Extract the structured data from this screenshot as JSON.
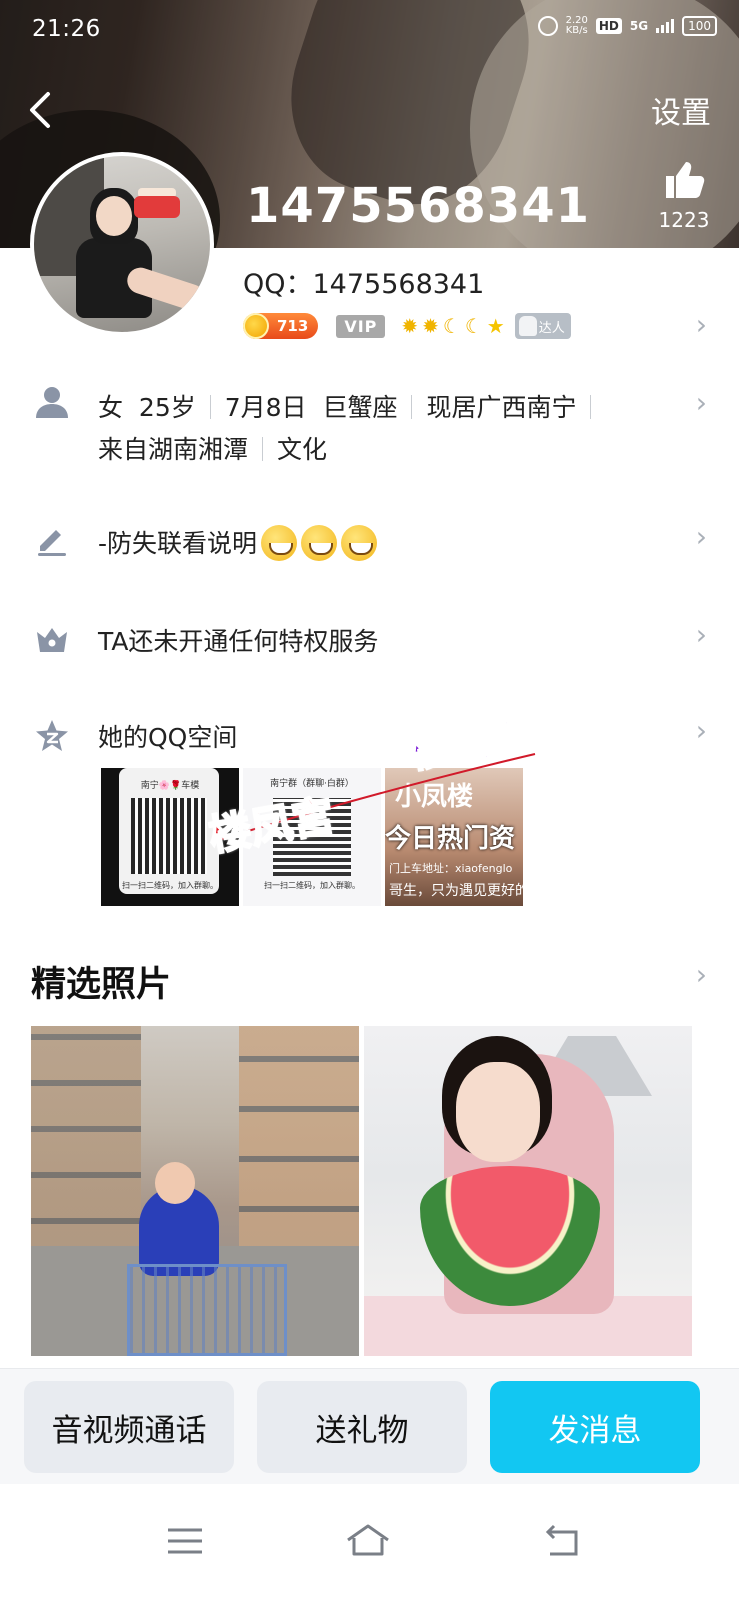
{
  "status_bar": {
    "time": "21:26",
    "net_speed_value": "2.20",
    "net_speed_unit": "KB/s",
    "hd": "HD",
    "network": "5G",
    "battery": "100"
  },
  "header": {
    "back_icon": "chevron-left-icon",
    "settings_label": "设置",
    "nickname": "1475568341",
    "like_icon": "thumbs-up-icon",
    "like_count": "1223"
  },
  "profile": {
    "qq_label": "QQ：1475568341",
    "coin_level": "713",
    "vip_label": "VIP",
    "level_icons": [
      "sun",
      "sun",
      "moon",
      "moon",
      "star"
    ],
    "talent_label": "达人"
  },
  "info": {
    "icon": "person-icon",
    "line1": [
      "女",
      "25岁",
      "7月8日",
      "巨蟹座",
      "现居广西南宁"
    ],
    "line2": [
      "来自湖南湘潭",
      "文化"
    ]
  },
  "signature": {
    "icon": "pencil-icon",
    "text": "-防失联看说明"
  },
  "privilege": {
    "icon": "crown-icon",
    "text": "TA还未开通任何特权服务"
  },
  "qzone": {
    "icon": "star-badge-icon",
    "title": "她的QQ空间",
    "thumb1_caption": "南宁🌸🌹车模",
    "thumb1_footer": "扫一扫二维码，加入群聊。",
    "thumb2_caption": "南宁群（群聊·白群）",
    "thumb2_footer": "扫一扫二维码，加入群聊。",
    "watermark_1": "楼凤宫",
    "watermark_2": "楼凤宫",
    "thumb3_title": "小凤楼",
    "thumb3_sub": "今日热门资",
    "thumb3_url": "门上车地址：xiaofenglo",
    "thumb3_footer": "哥生，只为遇见更好的"
  },
  "featured_photos": {
    "title": "精选照片"
  },
  "actions": {
    "call_label": "音视频通话",
    "gift_label": "送礼物",
    "message_label": "发消息"
  },
  "colors": {
    "primary_button": "#12c7f2",
    "secondary_button": "#e8ebf0",
    "icon_gray": "#8a94a6",
    "chevron": "#aab0b8"
  }
}
